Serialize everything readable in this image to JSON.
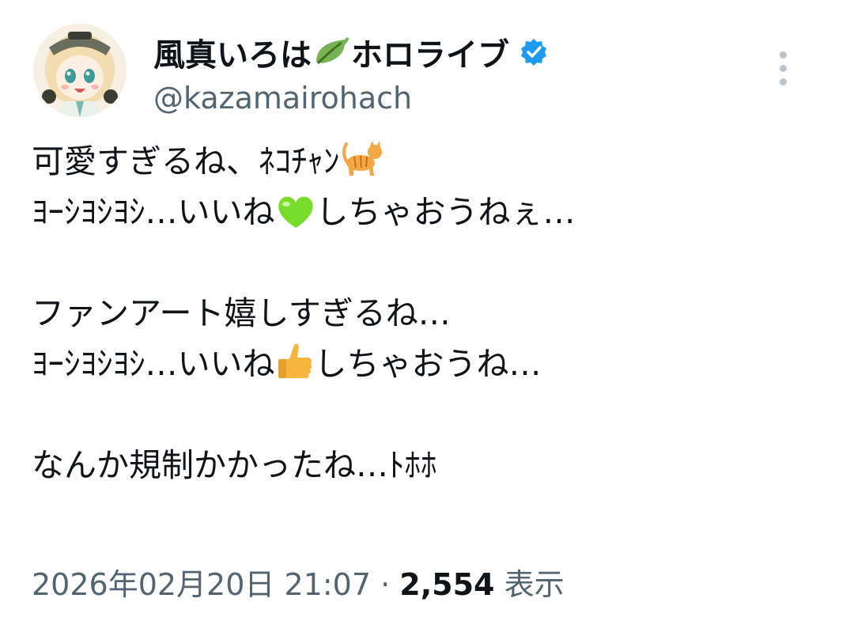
{
  "author": {
    "display_name": "風真いろは",
    "display_name_suffix": "ホロライブ",
    "handle": "@kazamairohach",
    "verified": true,
    "avatar_icon": "avatar-image",
    "leaf_icon": "leaf-emoji"
  },
  "tweet": {
    "line1_text": "可愛すぎるね、ﾈｺﾁｬﾝ",
    "line1_emoji": "cat-emoji",
    "line2_text_a": "ﾖｰｼﾖｼﾖｼ…いいね",
    "line2_emoji": "green-heart-emoji",
    "line2_text_b": "しちゃおうねぇ…",
    "line3_text": "ファンアート嬉しすぎるね…",
    "line4_text_a": "ﾖｰｼﾖｼﾖｼ…いいね",
    "line4_emoji": "thumbs-up-emoji",
    "line4_text_b": "しちゃおうね…",
    "line5_text": "なんか規制かかったね…ﾄﾎﾎ"
  },
  "meta": {
    "timestamp": "2026年02月20日 21:07",
    "separator": "·",
    "views_count": "2,554",
    "views_label": "表示"
  },
  "colors": {
    "text": "#0f1419",
    "secondary": "#536471",
    "verified": "#1d9bf0",
    "more_dots": "#b9c3cb"
  }
}
